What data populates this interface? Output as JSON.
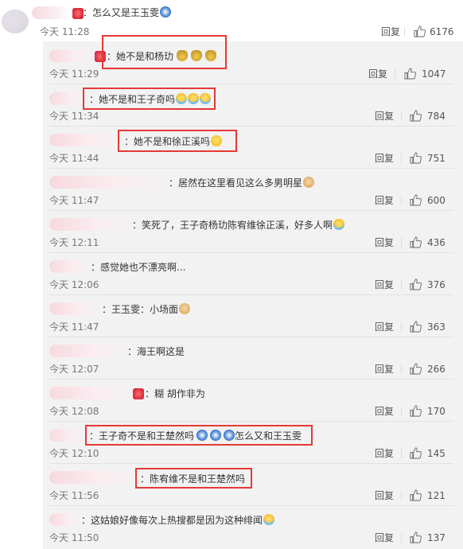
{
  "top_comment": {
    "text": "：怎么又是王玉雯",
    "time": "今天 11:28",
    "reply": "回复",
    "likes": "6176"
  },
  "replies": [
    {
      "text": "：她不是和杨玏",
      "emojis": [
        "monk",
        "monk",
        "monk"
      ],
      "time": "今天 11:29",
      "reply": "回复",
      "likes": "1047",
      "highlighted": true
    },
    {
      "text": "：她不是和王子奇吗",
      "emojis": [
        "laugh",
        "laugh",
        "laugh"
      ],
      "time": "今天 11:34",
      "reply": "回复",
      "likes": "784",
      "highlighted": true
    },
    {
      "text": "：她不是和徐正溪吗",
      "emojis": [
        "smile"
      ],
      "time": "今天 11:44",
      "reply": "回复",
      "likes": "751",
      "highlighted": true
    },
    {
      "text": "：居然在这里看见这么多男明星",
      "emojis": [
        "doge"
      ],
      "time": "今天 11:47",
      "reply": "回复",
      "likes": "600",
      "highlighted": false
    },
    {
      "text": "：笑死了，王子奇杨玏陈宥维徐正溪，好多人啊",
      "emojis": [
        "laugh"
      ],
      "time": "今天 12:11",
      "reply": "回复",
      "likes": "436",
      "highlighted": false
    },
    {
      "text": "：感觉她也不漂亮啊...",
      "emojis": [],
      "time": "今天 12:06",
      "reply": "回复",
      "likes": "376",
      "highlighted": false
    },
    {
      "text": "：王玉雯：小场面",
      "emojis": [
        "doge"
      ],
      "time": "今天 11:47",
      "reply": "回复",
      "likes": "363",
      "highlighted": false
    },
    {
      "text": "：海王啊这是",
      "emojis": [],
      "time": "今天 12:07",
      "reply": "回复",
      "likes": "266",
      "highlighted": false
    },
    {
      "text": "：糊 胡作非为",
      "emojis": [],
      "time": "今天 12:08",
      "reply": "回复",
      "likes": "170",
      "highlighted": false
    },
    {
      "text": "：王子奇不是和王楚然吗",
      "emojis_after": [
        "fox",
        "fox",
        "fox"
      ],
      "tail": "怎么又和王玉雯",
      "time": "今天 12:10",
      "reply": "回复",
      "likes": "145",
      "highlighted": true
    },
    {
      "text": "：陈宥维不是和王楚然吗",
      "emojis": [],
      "time": "今天 11:56",
      "reply": "回复",
      "likes": "121",
      "highlighted": true
    },
    {
      "text": "：这姑娘好像每次上热搜都是因为这种绯闻",
      "emojis": [
        "laugh"
      ],
      "time": "今天 11:50",
      "reply": "回复",
      "likes": "137",
      "highlighted": false
    }
  ]
}
